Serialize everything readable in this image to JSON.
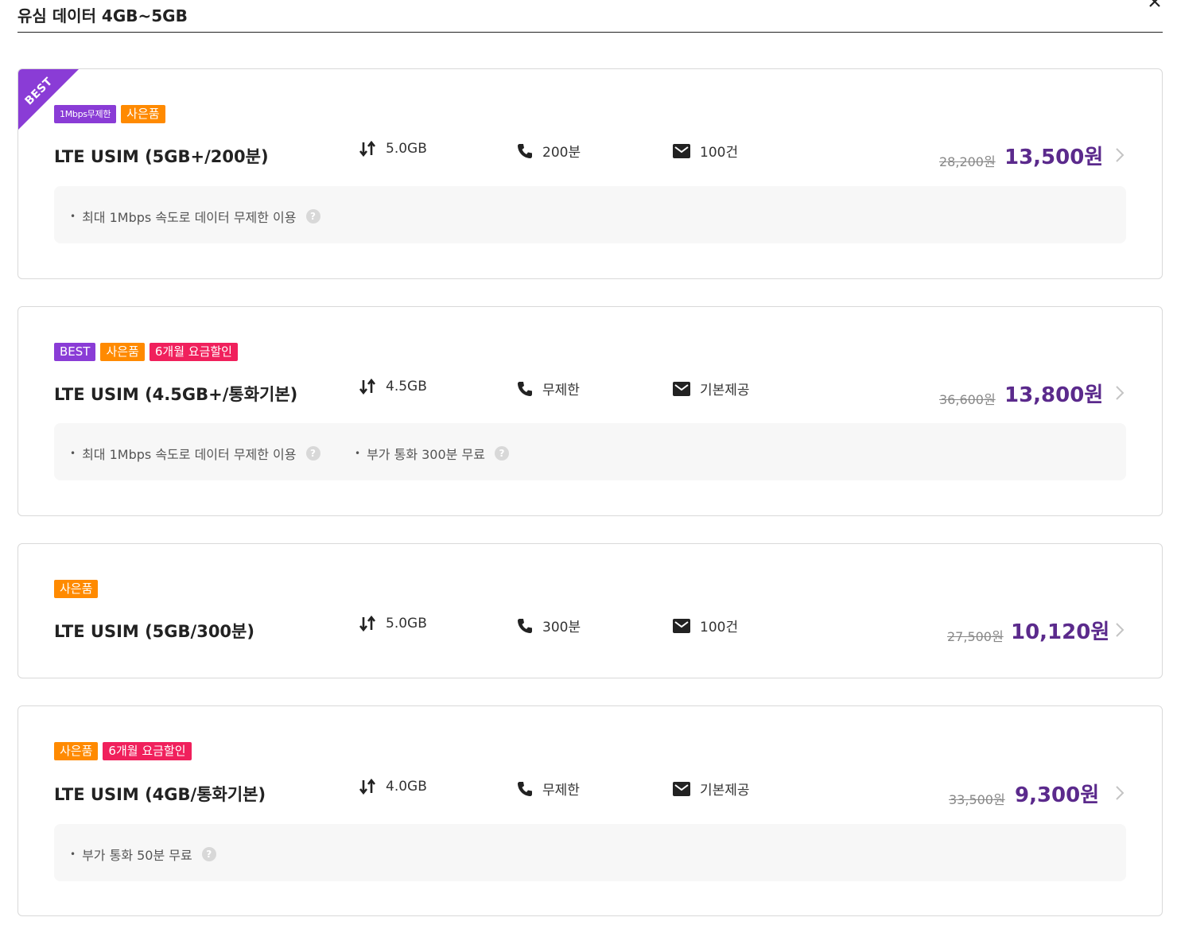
{
  "header": {
    "title": "유심 데이터 4GB~5GB"
  },
  "icons": {
    "close": "close-icon",
    "data": "data-updown-icon",
    "call": "phone-icon",
    "sms": "mail-icon",
    "more": "chevron-right-icon",
    "help": "help-icon"
  },
  "colors": {
    "price": "#5b2a8c",
    "best": "#8a3cd6",
    "gift": "#ff8a00",
    "discount": "#f0205c"
  },
  "plans": [
    {
      "ribbon": "BEST",
      "badges": [
        {
          "label": "1Mbps무제한"
        },
        {
          "label": "사은품"
        }
      ],
      "name": "LTE USIM (5GB+/200분)",
      "data": "5.0GB",
      "call": "200분",
      "sms": "100건",
      "price_old": "28,200원",
      "price_new": "13,500원",
      "notes": [
        "최대 1Mbps 속도로 데이터 무제한 이용"
      ]
    },
    {
      "badges": [
        {
          "label": "BEST"
        },
        {
          "label": "사은품"
        },
        {
          "label": "6개월 요금할인"
        }
      ],
      "name": "LTE USIM (4.5GB+/통화기본)",
      "data": "4.5GB",
      "call": "무제한",
      "sms": "기본제공",
      "price_old": "36,600원",
      "price_new": "13,800원",
      "notes": [
        "최대 1Mbps 속도로 데이터 무제한 이용",
        "부가 통화 300분 무료"
      ]
    },
    {
      "badges": [
        {
          "label": "사은품"
        }
      ],
      "name": "LTE USIM (5GB/300분)",
      "data": "5.0GB",
      "call": "300분",
      "sms": "100건",
      "price_old": "27,500원",
      "price_new": "10,120원"
    },
    {
      "badges": [
        {
          "label": "사은품"
        },
        {
          "label": "6개월 요금할인"
        }
      ],
      "name": "LTE USIM (4GB/통화기본)",
      "data": "4.0GB",
      "call": "무제한",
      "sms": "기본제공",
      "price_old": "33,500원",
      "price_new": "9,300원",
      "notes": [
        "부가 통화 50분 무료"
      ]
    }
  ]
}
